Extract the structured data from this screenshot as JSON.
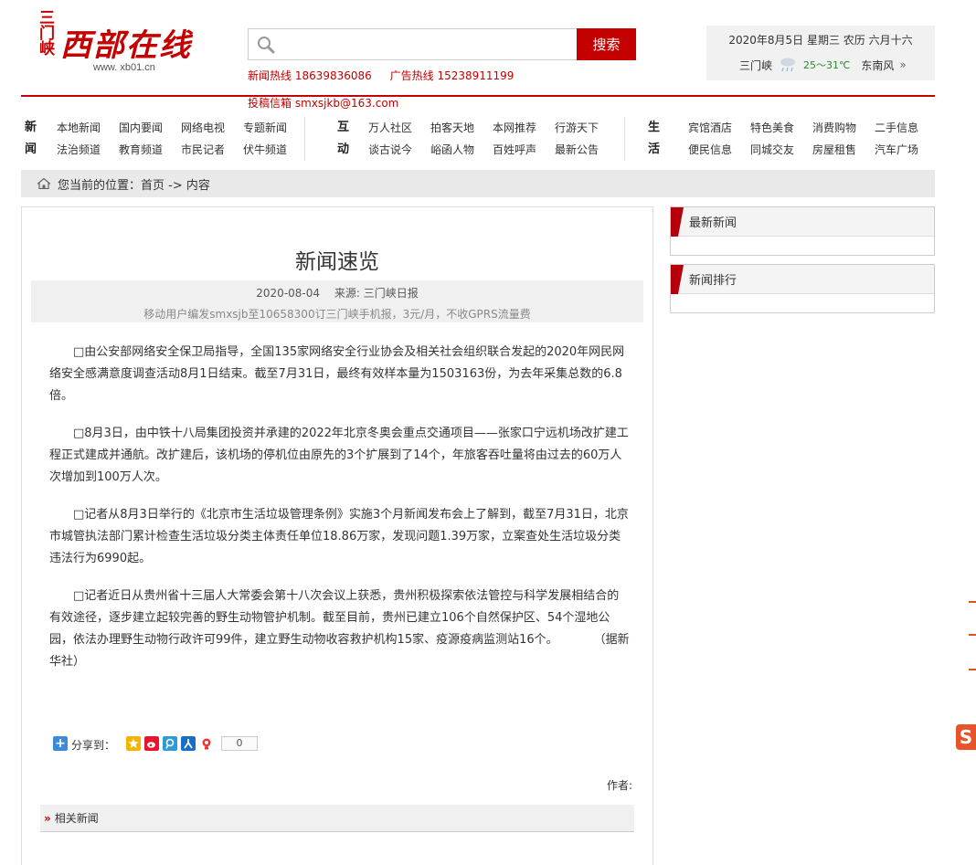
{
  "header": {
    "logo_side": "三门峡",
    "logo_main": "西部在线",
    "logo_url": "www. xb01.cn",
    "search_placeholder": "",
    "search_button": "搜索",
    "news_hotline": "新闻热线 18639836086",
    "ad_hotline": "广告热线 15238911199",
    "mail": "投稿信箱 smxsjkb@163.com"
  },
  "weather": {
    "date": "2020年8月5日 星期三 农历 六月十六",
    "city": "三门峡",
    "temp": "25～31℃",
    "wind": "东南风",
    "more": "»"
  },
  "nav": {
    "groups": [
      {
        "head": [
          "新",
          "闻"
        ],
        "links": [
          "本地新闻",
          "国内要闻",
          "网络电视",
          "专题新闻",
          "法治频道",
          "教育频道",
          "市民记者",
          "伏牛频道"
        ]
      },
      {
        "head": [
          "互",
          "动"
        ],
        "links": [
          "万人社区",
          "拍客天地",
          "本网推荐",
          "行游天下",
          "谈古说今",
          "峪函人物",
          "百姓呼声",
          "最新公告"
        ]
      },
      {
        "head": [
          "生",
          "活"
        ],
        "links": [
          "宾馆酒店",
          "特色美食",
          "消费购物",
          "二手信息",
          "便民信息",
          "同城交友",
          "房屋租售",
          "汽车广场"
        ]
      }
    ]
  },
  "breadcrumb": "您当前的位置：首页 -> 内容",
  "article": {
    "title": "新闻速览",
    "date": "2020-08-04",
    "source": "来源: 三门峡日报",
    "sms": "移动用户编发smxsjb至10658300订三门峡手机报，3元/月，不收GPRS流量费",
    "paragraphs": [
      "□由公安部网络安全保卫局指导，全国135家网络安全行业协会及相关社会组织联合发起的2020年网民网络安全感满意度调查活动8月1日结束。截至7月31日，最终有效样本量为1503163份，为去年采集总数的6.8倍。",
      "□8月3日，由中铁十八局集团投资并承建的2022年北京冬奥会重点交通项目——张家口宁远机场改扩建工程正式建成并通航。改扩建后，该机场的停机位由原先的3个扩展到了14个，年旅客吞吐量将由过去的60万人次增加到100万人次。",
      "□记者从8月3日举行的《北京市生活垃圾管理条例》实施3个月新闻发布会上了解到，截至7月31日，北京市城管执法部门累计检查生活垃圾分类主体责任单位18.86万家，发现问题1.39万家，立案查处生活垃圾分类违法行为6990起。",
      "□记者近日从贵州省十三届人大常委会第十八次会议上获悉，贵州积极探索依法管控与科学发展相结合的有效途径，逐步建立起较完善的野生动物管护机制。截至目前，贵州已建立106个自然保护区、54个湿地公园，依法办理野生动物行政许可99件，建立野生动物收容救护机构15家、疫源疫病监测站16个。　　　　（据新华社）"
    ],
    "share_label": "分享到：",
    "share_count": "0",
    "author": "作者:",
    "related": "相关新闻"
  },
  "sidebar": {
    "latest": "最新新闻",
    "ranking": "新闻排行"
  },
  "colors": {
    "brand": "#c40000",
    "weather_temp": "#2a8a2a"
  }
}
